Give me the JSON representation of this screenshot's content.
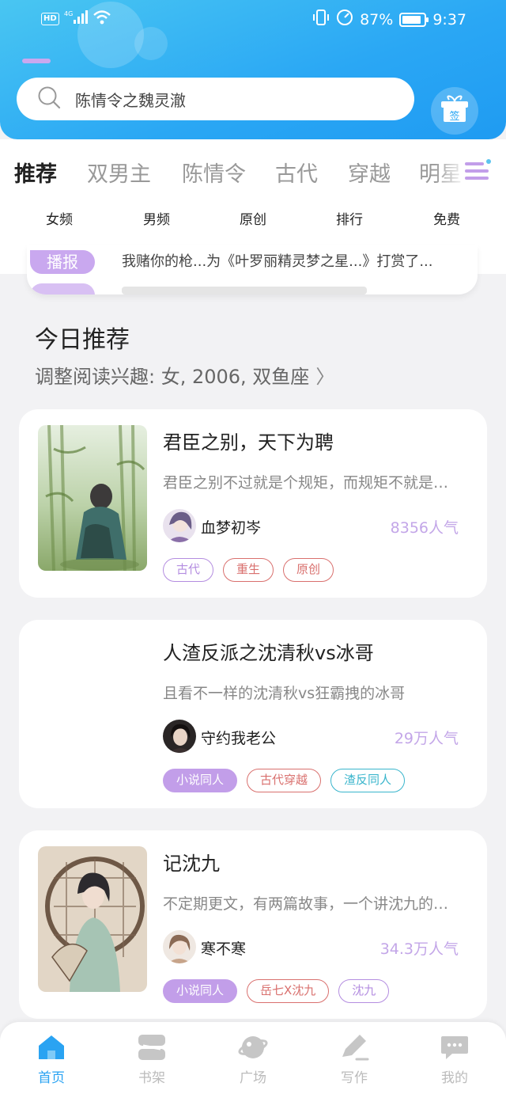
{
  "status_bar": {
    "battery": "87%",
    "time": "9:37",
    "network": "4G",
    "hd": "HD"
  },
  "search": {
    "text": "陈情令之魏灵澈"
  },
  "gift_button": {
    "label": "签"
  },
  "tabs": [
    {
      "label": "推荐",
      "active": true
    },
    {
      "label": "双男主"
    },
    {
      "label": "陈情令"
    },
    {
      "label": "古代"
    },
    {
      "label": "穿越"
    },
    {
      "label": "明星"
    }
  ],
  "subcategories": [
    "女频",
    "男频",
    "原创",
    "排行",
    "免费"
  ],
  "news": {
    "tag": "播报",
    "text": "我赌你的枪...为《叶罗丽精灵梦之星...》打赏了..."
  },
  "section": {
    "title": "今日推荐",
    "subtitle": "调整阅读兴趣: 女, 2006, 双鱼座",
    "chevron": "〉"
  },
  "books": [
    {
      "title": "君臣之别，天下为聘",
      "desc": "君臣之别不过就是个规矩，而规矩不就是用来打破的吗",
      "author": "血梦初岑",
      "popularity": "8356人气",
      "tags": [
        {
          "label": "古代",
          "style": "purple-outline"
        },
        {
          "label": "重生",
          "style": "red-outline"
        },
        {
          "label": "原创",
          "style": "red-outline"
        }
      ]
    },
    {
      "title": "人渣反派之沈清秋vs冰哥",
      "desc": "且看不一样的沈清秋vs狂霸拽的冰哥",
      "author": "守约我老公",
      "popularity": "29万人气",
      "tags": [
        {
          "label": "小说同人",
          "style": "purple-filled"
        },
        {
          "label": "古代穿越",
          "style": "red-outline"
        },
        {
          "label": "渣反同人",
          "style": "cyan-outline"
        }
      ]
    },
    {
      "title": "记沈九",
      "desc": "不定期更文，有两篇故事，一个讲沈九的，一个讲沈清秋的",
      "author": "寒不寒",
      "popularity": "34.3万人气",
      "tags": [
        {
          "label": "小说同人",
          "style": "purple-filled"
        },
        {
          "label": "岳七X沈九",
          "style": "red-outline"
        },
        {
          "label": "沈九",
          "style": "purple-outline"
        }
      ]
    }
  ],
  "bottom_nav": [
    {
      "label": "首页",
      "icon": "home-icon",
      "active": true
    },
    {
      "label": "书架",
      "icon": "bookshelf-icon"
    },
    {
      "label": "广场",
      "icon": "planet-icon"
    },
    {
      "label": "写作",
      "icon": "pen-icon"
    },
    {
      "label": "我的",
      "icon": "chat-icon"
    }
  ],
  "colors": {
    "accent": "#2aa3f2",
    "purple": "#c29ee9",
    "red": "#d9706e",
    "cyan": "#39b5cc"
  }
}
